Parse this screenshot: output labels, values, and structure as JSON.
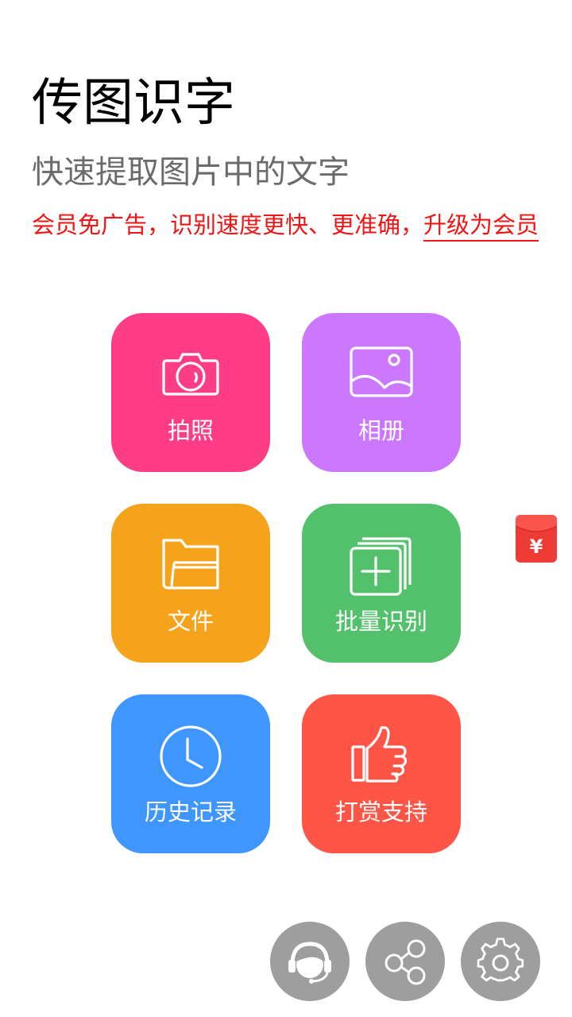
{
  "header": {
    "title": "传图识字",
    "subtitle": "快速提取图片中的文字",
    "promo_text": "会员免广告，识别速度更快、更准确，",
    "promo_link": "升级为会员"
  },
  "tiles": {
    "camera": {
      "label": "拍照",
      "color": "#fe3d86"
    },
    "album": {
      "label": "相册",
      "color": "#cb78fe"
    },
    "file": {
      "label": "文件",
      "color": "#f5a31a"
    },
    "batch": {
      "label": "批量识别",
      "color": "#53c16c"
    },
    "history": {
      "label": "历史记录",
      "color": "#3f96ff"
    },
    "reward": {
      "label": "打赏支持",
      "color": "#fe5546"
    }
  },
  "floating": {
    "red_packet_icon": "red-envelope-yuan-icon",
    "red_packet_symbol": "¥"
  },
  "bottom_buttons": {
    "support_icon": "customer-service-icon",
    "share_icon": "share-icon",
    "settings_icon": "gear-icon",
    "color": "#9e9e9e"
  }
}
